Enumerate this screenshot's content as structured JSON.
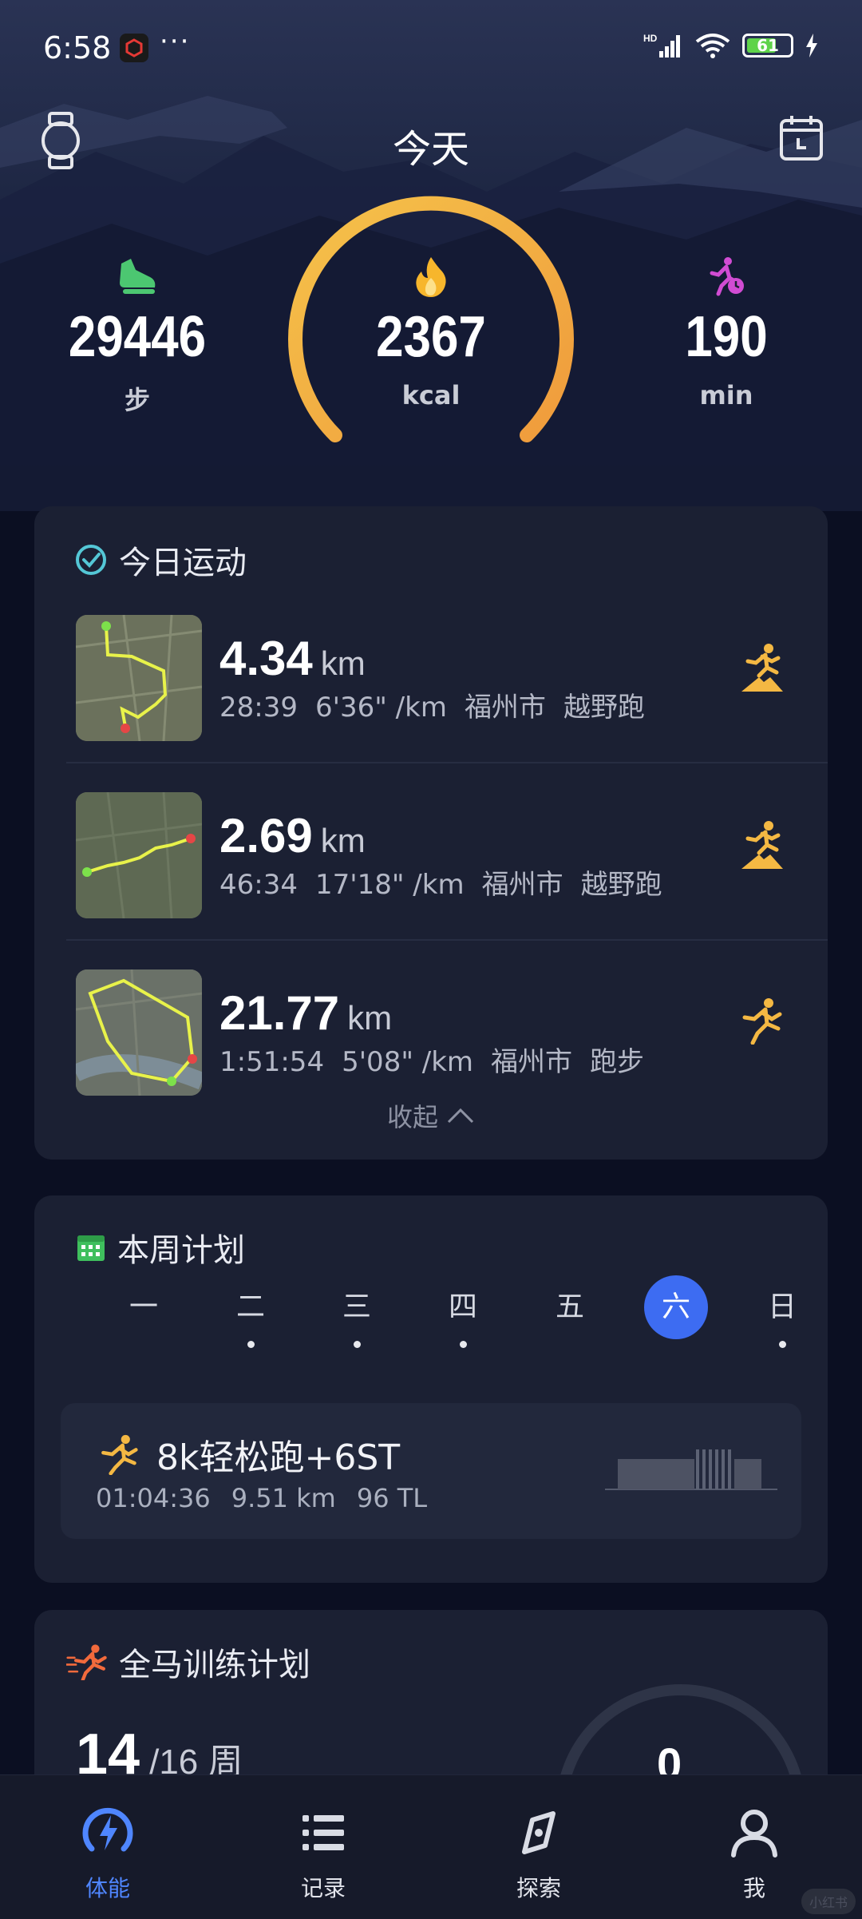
{
  "status_bar": {
    "time": "6:58",
    "overflow": "···",
    "battery": "61",
    "network": "HD"
  },
  "header": {
    "title": "今天"
  },
  "stats": {
    "steps": {
      "value": "29446",
      "unit": "步"
    },
    "kcal": {
      "value": "2367",
      "unit": "kcal"
    },
    "minutes": {
      "value": "190",
      "unit": "min"
    }
  },
  "today_workouts": {
    "title": "今日运动",
    "items": [
      {
        "distance": "4.34",
        "unit": "km",
        "duration": "28:39",
        "pace": "6'36\" /km",
        "location": "福州市",
        "type": "越野跑"
      },
      {
        "distance": "2.69",
        "unit": "km",
        "duration": "46:34",
        "pace": "17'18\" /km",
        "location": "福州市",
        "type": "越野跑"
      },
      {
        "distance": "21.77",
        "unit": "km",
        "duration": "1:51:54",
        "pace": "5'08\" /km",
        "location": "福州市",
        "type": "跑步"
      }
    ],
    "collapse_label": "收起"
  },
  "week_plan": {
    "title": "本周计划",
    "days": [
      "一",
      "二",
      "三",
      "四",
      "五",
      "六",
      "日"
    ],
    "selected_day": "六",
    "plan": {
      "name": "8k轻松跑+6ST",
      "duration": "01:04:36",
      "distance": "9.51 km",
      "load": "96 TL"
    }
  },
  "marathon_plan": {
    "title": "全马训练计划",
    "current_week": "14",
    "total_weeks": "/16 周",
    "ring_value": "0"
  },
  "bottom_nav": [
    {
      "label": "体能",
      "icon": "lightning-icon",
      "active": true
    },
    {
      "label": "记录",
      "icon": "list-icon",
      "active": false
    },
    {
      "label": "探索",
      "icon": "compass-icon",
      "active": false
    },
    {
      "label": "我",
      "icon": "person-icon",
      "active": false
    }
  ],
  "colors": {
    "accent": "#3d6cf2",
    "gauge_start": "#f5c24a",
    "gauge_end": "#f0a040",
    "card": "#1b2033",
    "nav_active": "#4f86ff"
  },
  "watermark": "小红书"
}
